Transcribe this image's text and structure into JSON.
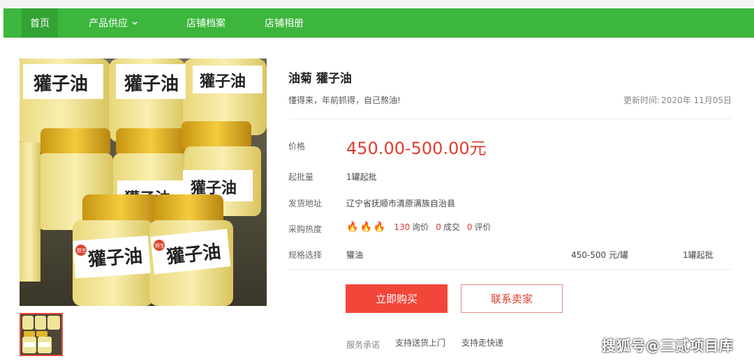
{
  "nav": {
    "items": [
      {
        "label": "首页",
        "active": true
      },
      {
        "label": "产品供应",
        "has_dropdown": true
      },
      {
        "label": "店铺档案"
      },
      {
        "label": "店铺相册"
      }
    ]
  },
  "product": {
    "title": "油菊 獾子油",
    "subtitle": "懂得来，年前抓得，自己熬油!",
    "update_label": "更新时间:",
    "update_value": "2020年 11月05日",
    "jar_label": "獾子油",
    "jar_tag": "野生",
    "price_label": "价格",
    "price": "450.00-500.00元",
    "min_order_label": "起批量",
    "min_order": "1罐起批",
    "ship_label": "发货地址",
    "ship_address": "辽宁省抚顺市清原满族自治县",
    "heat_label": "采购热度",
    "heat": {
      "flames": 3,
      "inquiries": "130",
      "inquiries_label": "询价",
      "deals": "0",
      "deals_label": "成交",
      "reviews": "0",
      "reviews_label": "评价"
    },
    "spec_label": "规格选择",
    "spec": {
      "name": "獾油",
      "price": "450-500 元/罐",
      "min": "1罐起批"
    },
    "buy_button": "立即购买",
    "contact_button": "联系卖家",
    "service_label": "服务承诺",
    "services": [
      "支持送货上门",
      "支持走快递"
    ]
  },
  "watermark": "搜狐号@三贰项目库",
  "colors": {
    "nav_green": "#3db63d",
    "accent_red": "#e33b2e",
    "buy_red": "#f2463a"
  }
}
